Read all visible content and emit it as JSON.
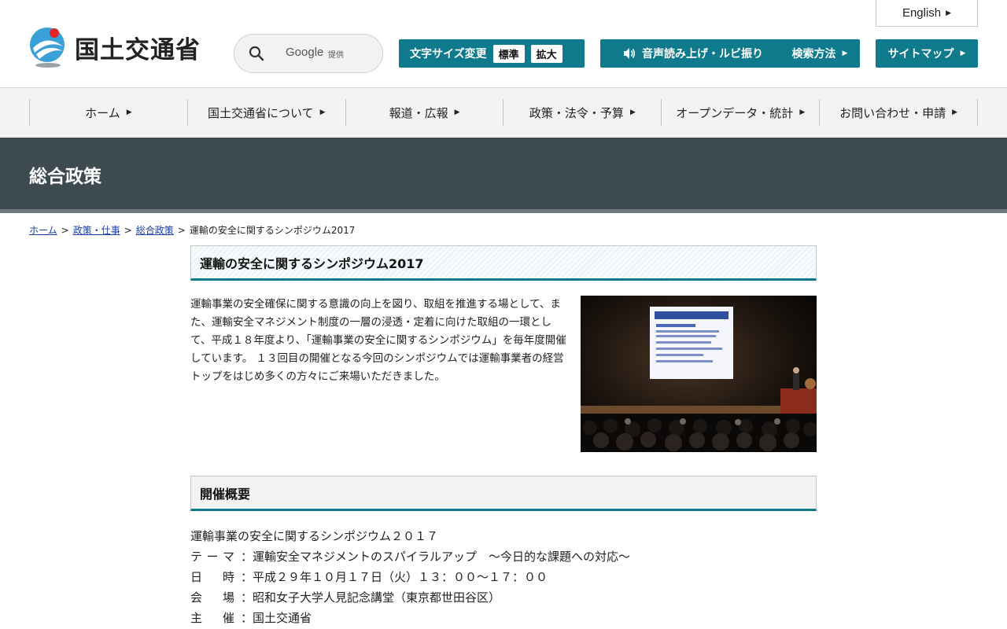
{
  "header": {
    "logo_text": "国土交通省",
    "search": {
      "provider": "Google",
      "provided_label": "提供"
    },
    "english_label": "English",
    "font_size_label": "文字サイズ変更",
    "font_size_standard": "標準",
    "font_size_large": "拡大",
    "voice_label": "音声読み上げ・ルビ振り",
    "search_method_label": "検索方法",
    "sitemap_label": "サイトマップ",
    "accent_color": "#0e7a8c"
  },
  "nav": {
    "items": [
      {
        "label": "ホーム"
      },
      {
        "label": "国土交通省について"
      },
      {
        "label": "報道・広報"
      },
      {
        "label": "政策・法令・予算"
      },
      {
        "label": "オープンデータ・統計"
      },
      {
        "label": "お問い合わせ・申請"
      }
    ]
  },
  "banner": {
    "title": "総合政策",
    "color": "#3d4a50"
  },
  "breadcrumb": {
    "items": [
      {
        "label": "ホーム"
      },
      {
        "label": "政策・仕事"
      },
      {
        "label": "総合政策"
      }
    ],
    "current": "運輸の安全に関するシンポジウム2017",
    "separator": ">"
  },
  "main": {
    "title": "運輸の安全に関するシンポジウム2017",
    "intro": "運輸事業の安全確保に関する意識の向上を図り、取組を推進する場として、また、運輸安全マネジメント制度の一層の浸透・定着に向けた取組の一環として、平成１８年度より、「運輸事業の安全に関するシンポジウム」を毎年度開催しています。 １３回目の開催となる今回のシンポジウムでは運輸事業者の経営トップをはじめ多くの方々にご来場いただきました。",
    "overview_heading": "開催概要",
    "overview_title": "運輸事業の安全に関するシンポジウム２０１７",
    "overview_rows": [
      {
        "key_a": "テ",
        "key_b": "ー",
        "key_c": "マ",
        "value": "：運輸安全マネジメントのスパイラルアップ　～今日的な課題への対応～"
      },
      {
        "key_a": "日",
        "key_b": "",
        "key_c": "時",
        "value": "：平成２９年１０月１７日（火）１３：００～１７：００"
      },
      {
        "key_a": "会",
        "key_b": "",
        "key_c": "場",
        "value": "：昭和女子大学人見記念講堂（東京都世田谷区）"
      },
      {
        "key_a": "主",
        "key_b": "",
        "key_c": "催",
        "value": "：国土交通省"
      }
    ]
  }
}
